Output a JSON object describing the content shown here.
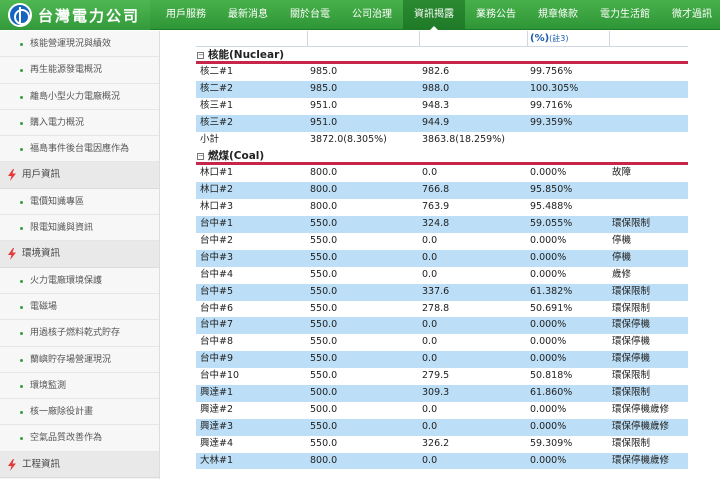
{
  "header": {
    "logo_text": "台灣電力公司",
    "nav": [
      "用戶服務",
      "最新消息",
      "關於台電",
      "公司治理",
      "資訊揭露",
      "業務公告",
      "規章條款",
      "電力生活館",
      "微才過訊"
    ],
    "active_nav": 4
  },
  "sidebar": {
    "items": [
      {
        "type": "item",
        "label": "核能營運現況與績效"
      },
      {
        "type": "item",
        "label": "再生能源發電概況"
      },
      {
        "type": "item",
        "label": "離島小型火力電廠概況"
      },
      {
        "type": "item",
        "label": "購入電力概況"
      },
      {
        "type": "item",
        "label": "福島事件後台電因應作為"
      },
      {
        "type": "category",
        "label": "用戶資訊"
      },
      {
        "type": "item",
        "label": "電價知識專區"
      },
      {
        "type": "item",
        "label": "限電知識與資訊"
      },
      {
        "type": "category",
        "label": "環境資訊"
      },
      {
        "type": "item",
        "label": "火力電廠環境保護"
      },
      {
        "type": "item",
        "label": "電磁場"
      },
      {
        "type": "item",
        "label": "用過核子燃料乾式貯存"
      },
      {
        "type": "item",
        "label": "蘭嶼貯存場營運現況"
      },
      {
        "type": "item",
        "label": "環境監測"
      },
      {
        "type": "item",
        "label": "核一廠除役計畫"
      },
      {
        "type": "item",
        "label": "空氣品質改善作為"
      },
      {
        "type": "category",
        "label": "工程資訊"
      }
    ]
  },
  "table": {
    "header_partial": "(%)",
    "header_note": "(註3)",
    "sections": [
      {
        "title": "核能(Nuclear)",
        "rows": [
          [
            "核二#1",
            "985.0",
            "982.6",
            "99.756%",
            ""
          ],
          [
            "核二#2",
            "985.0",
            "988.0",
            "100.305%",
            ""
          ],
          [
            "核三#1",
            "951.0",
            "948.3",
            "99.716%",
            ""
          ],
          [
            "核三#2",
            "951.0",
            "944.9",
            "99.359%",
            ""
          ],
          [
            "小計",
            "3872.0(8.305%)",
            "3863.8(18.259%)",
            "",
            ""
          ]
        ]
      },
      {
        "title": "燃煤(Coal)",
        "rows": [
          [
            "林口#1",
            "800.0",
            "0.0",
            "0.000%",
            "故障"
          ],
          [
            "林口#2",
            "800.0",
            "766.8",
            "95.850%",
            ""
          ],
          [
            "林口#3",
            "800.0",
            "763.9",
            "95.488%",
            ""
          ],
          [
            "台中#1",
            "550.0",
            "324.8",
            "59.055%",
            "環保限制"
          ],
          [
            "台中#2",
            "550.0",
            "0.0",
            "0.000%",
            "停機"
          ],
          [
            "台中#3",
            "550.0",
            "0.0",
            "0.000%",
            "停機"
          ],
          [
            "台中#4",
            "550.0",
            "0.0",
            "0.000%",
            "歲修"
          ],
          [
            "台中#5",
            "550.0",
            "337.6",
            "61.382%",
            "環保限制"
          ],
          [
            "台中#6",
            "550.0",
            "278.8",
            "50.691%",
            "環保限制"
          ],
          [
            "台中#7",
            "550.0",
            "0.0",
            "0.000%",
            "環保停機"
          ],
          [
            "台中#8",
            "550.0",
            "0.0",
            "0.000%",
            "環保停機"
          ],
          [
            "台中#9",
            "550.0",
            "0.0",
            "0.000%",
            "環保停機"
          ],
          [
            "台中#10",
            "550.0",
            "279.5",
            "50.818%",
            "環保限制"
          ],
          [
            "興達#1",
            "500.0",
            "309.3",
            "61.860%",
            "環保限制"
          ],
          [
            "興達#2",
            "500.0",
            "0.0",
            "0.000%",
            "環保停機歲修"
          ],
          [
            "興達#3",
            "550.0",
            "0.0",
            "0.000%",
            "環保停機歲修"
          ],
          [
            "興達#4",
            "550.0",
            "326.2",
            "59.309%",
            "環保限制"
          ],
          [
            "大林#1",
            "800.0",
            "0.0",
            "0.000%",
            "環保停機歲修"
          ]
        ]
      }
    ]
  },
  "colors": {
    "nav_green": "#3aa33f",
    "row_blue": "#bcdff7",
    "section_rule": "#c8254a",
    "header_blue": "#1a5bb0"
  }
}
